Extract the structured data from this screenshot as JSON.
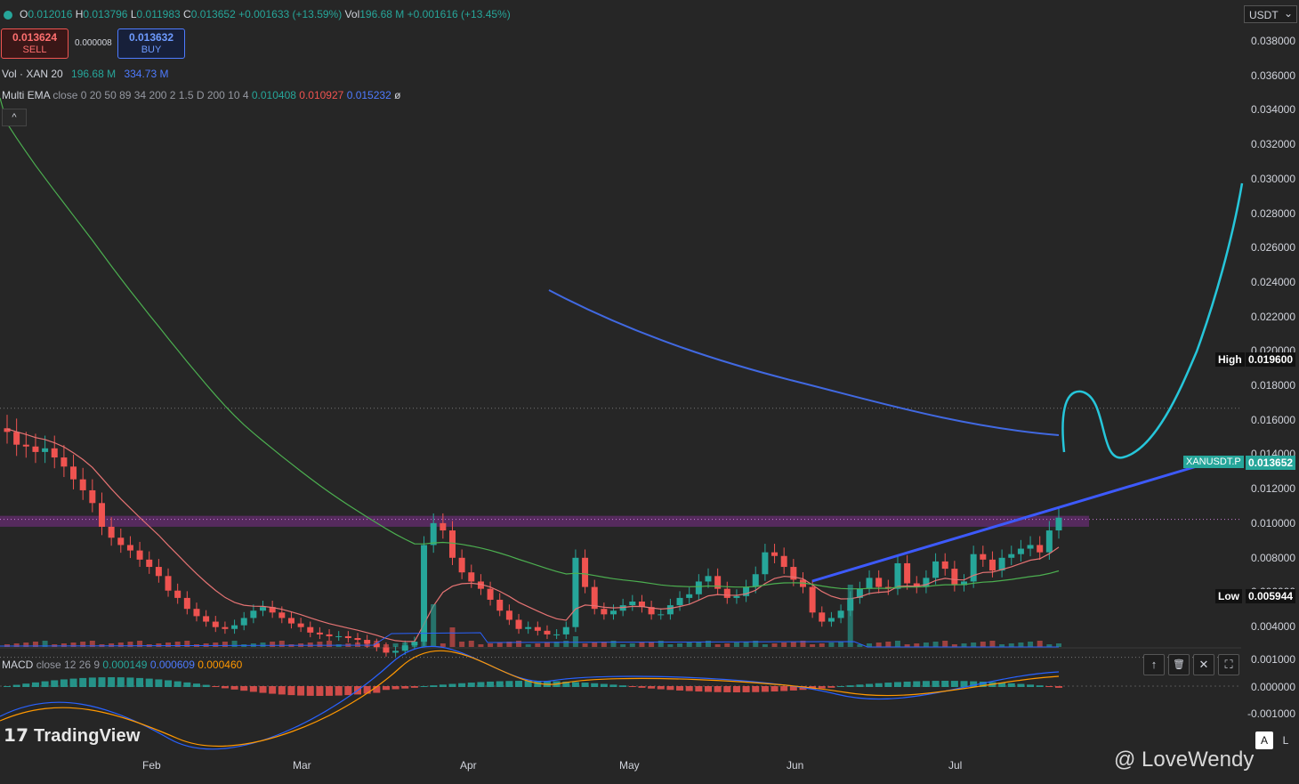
{
  "header": {
    "ohlc": {
      "o_label": "O",
      "o_value": "0.012016",
      "h_label": "H",
      "h_value": "0.013796",
      "l_label": "L",
      "l_value": "0.011983",
      "c_label": "C",
      "c_value": "0.013652",
      "change": "+0.001633 (+13.59%)",
      "vol_label": "Vol",
      "vol_value": "196.68 M",
      "vol_change": "+0.001616 (+13.45%)"
    },
    "sell": {
      "price": "0.013624",
      "label": "SELL"
    },
    "buy": {
      "price": "0.013632",
      "label": "BUY"
    },
    "spread": "0.000008",
    "vol_indicator": {
      "name": "Vol · XAN 20",
      "v1": "196.68 M",
      "v2": "334.73 M"
    },
    "ema_indicator": {
      "name": "Multi EMA",
      "params": "close 0 20 50 89 34 200 2 1.5 D 200 10 4",
      "v1": "0.010408",
      "v2": "0.010927",
      "v3": "0.015232",
      "v4": "ø"
    },
    "collapse": "^"
  },
  "currency": "USDT",
  "currency_chevron": "⌄",
  "price_axis": [
    "0.038000",
    "0.036000",
    "0.034000",
    "0.032000",
    "0.030000",
    "0.028000",
    "0.026000",
    "0.024000",
    "0.022000",
    "0.020000",
    "0.018000",
    "0.016000",
    "0.014000",
    "0.012000",
    "0.010000",
    "0.008000",
    "0.006000",
    "0.004000"
  ],
  "tags": {
    "high_label": "High",
    "high_value": "0.019600",
    "current_label": "XANUSDT.P",
    "current_value": "0.013652",
    "low_label": "Low",
    "low_value": "0.005944"
  },
  "macd": {
    "name": "MACD",
    "params": "close 12 26 9",
    "v1": "0.000149",
    "v2": "0.000609",
    "v3": "0.000460",
    "axis": [
      "0.001000",
      "0.000000",
      "-0.001000"
    ]
  },
  "macd_controls": [
    "↑",
    "🗑",
    "✕",
    "⛶"
  ],
  "months": [
    "Feb",
    "Mar",
    "Apr",
    "May",
    "Jun",
    "Jul"
  ],
  "brand": "TradingView",
  "watermark": "@ LoveWendy",
  "scale_buttons": {
    "a": "A",
    "l": "L"
  },
  "colors": {
    "up": "#26a69a",
    "down": "#ef5350",
    "trend": "#3d5afe",
    "projection": "#26c6da",
    "ema_green": "#4caf50",
    "ema_red": "#e57373",
    "ema_blue": "#4169e1",
    "zone": "#7b2d8b",
    "background": "#262626"
  },
  "chart_data": {
    "type": "candlestick",
    "symbol": "XANUSDT.P",
    "y_range": [
      0.003,
      0.039
    ],
    "last_close": 0.013652,
    "high": 0.0196,
    "low": 0.005944,
    "resistance_zone": [
      0.0131,
      0.0137
    ],
    "x_labels": [
      "Feb",
      "Mar",
      "Apr",
      "May",
      "Jun",
      "Jul"
    ],
    "closes": [
      0.0183,
      0.0176,
      0.0175,
      0.0172,
      0.0174,
      0.0169,
      0.0164,
      0.0157,
      0.0151,
      0.0144,
      0.0131,
      0.0125,
      0.0121,
      0.0118,
      0.0113,
      0.0109,
      0.0104,
      0.0096,
      0.0092,
      0.0086,
      0.0082,
      0.0079,
      0.0076,
      0.0075,
      0.0077,
      0.0081,
      0.0085,
      0.0087,
      0.0084,
      0.0081,
      0.0078,
      0.0076,
      0.0073,
      0.0072,
      0.0071,
      0.0071,
      0.007,
      0.0069,
      0.0067,
      0.0065,
      0.0062,
      0.0063,
      0.0066,
      0.0068,
      0.0121,
      0.0133,
      0.0129,
      0.0114,
      0.0106,
      0.0101,
      0.0097,
      0.0091,
      0.0085,
      0.008,
      0.0075,
      0.0076,
      0.0074,
      0.0072,
      0.0072,
      0.0076,
      0.0114,
      0.0098,
      0.0086,
      0.0083,
      0.0085,
      0.0088,
      0.009,
      0.0087,
      0.0083,
      0.0083,
      0.0088,
      0.0092,
      0.0094,
      0.0101,
      0.0104,
      0.0097,
      0.0092,
      0.0093,
      0.0098,
      0.0105,
      0.0117,
      0.0115,
      0.0109,
      0.0102,
      0.0098,
      0.0084,
      0.0079,
      0.0081,
      0.0085,
      0.0092,
      0.0097,
      0.0103,
      0.0098,
      0.0097,
      0.0111,
      0.01,
      0.0098,
      0.0103,
      0.0112,
      0.0108,
      0.0099,
      0.0101,
      0.0116,
      0.0113,
      0.0107,
      0.0114,
      0.0116,
      0.0119,
      0.0121,
      0.0117,
      0.0129,
      0.0136
    ],
    "volume_spikes": [
      {
        "month": "Mar",
        "label": "spike"
      },
      {
        "month": "Jun",
        "label": "spike"
      }
    ],
    "macd_series": [
      "MACD",
      "Signal",
      "Histogram"
    ]
  }
}
